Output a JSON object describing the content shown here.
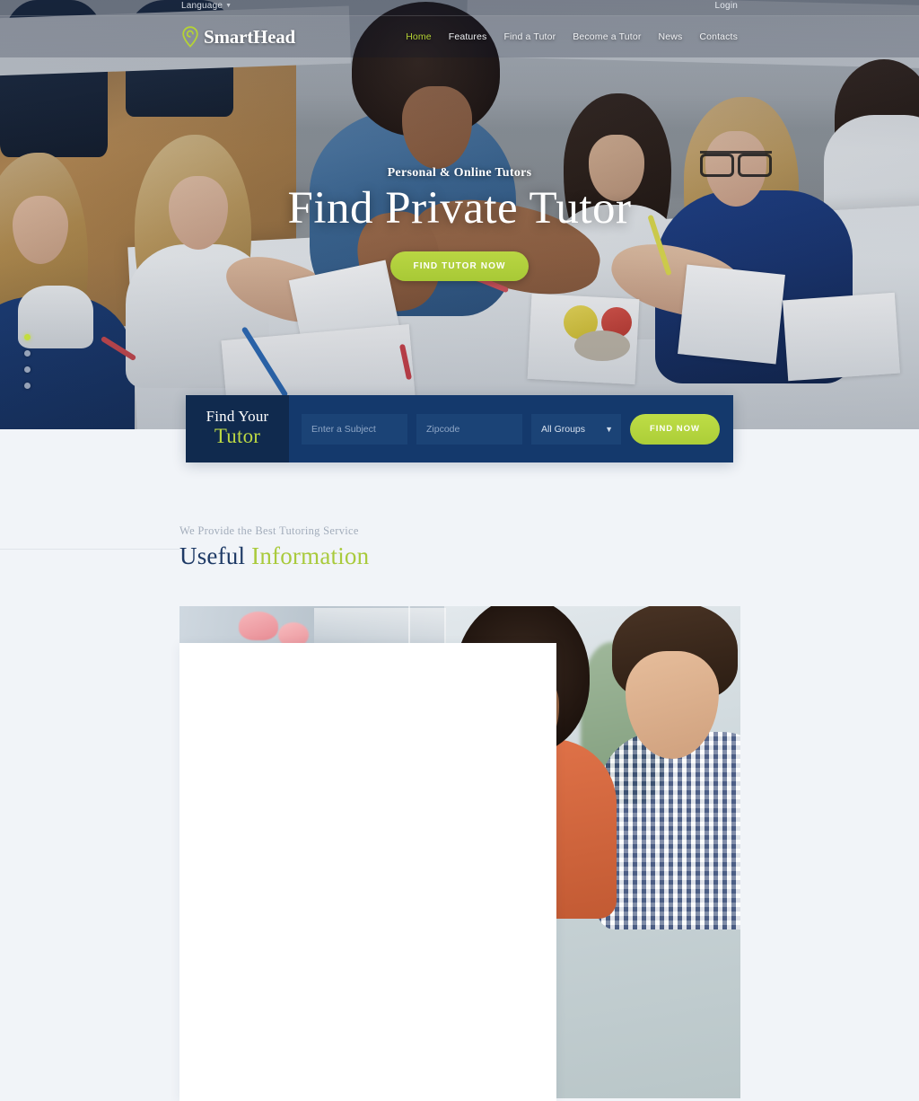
{
  "topbar": {
    "language_label": "Language",
    "language_chevron": "chevron-down-icon",
    "login_label": "Login"
  },
  "header": {
    "logo_text": "SmartHead",
    "logo_icon": "location-pin-icon",
    "nav": [
      {
        "label": "Home",
        "active": true
      },
      {
        "label": "Features",
        "active": false
      },
      {
        "label": "Find a Tutor",
        "active": false
      },
      {
        "label": "Become a Tutor",
        "active": false
      },
      {
        "label": "News",
        "active": false
      },
      {
        "label": "Contacts",
        "active": false
      }
    ]
  },
  "hero": {
    "subtitle": "Personal & Online Tutors",
    "title": "Find Private Tutor",
    "cta_label": "FIND TUTOR NOW",
    "slider_dots": 4,
    "active_dot": 1
  },
  "search_panel": {
    "label_line1": "Find Your",
    "label_line2": "Tutor",
    "subject_placeholder": "Enter a Subject",
    "subject_value": "",
    "zipcode_placeholder": "Zipcode",
    "zipcode_value": "",
    "group_selected": "All Groups",
    "group_options": [
      "All Groups"
    ],
    "group_chevron": "chevron-down-icon",
    "submit_label": "FIND NOW"
  },
  "section": {
    "eyebrow": "We Provide the Best Tutoring Service",
    "title_part1": "Useful",
    "title_part2": "Information"
  },
  "colors": {
    "green": "#b5d334",
    "navy": "#102a4e",
    "panel_blue": "#14396c",
    "field_blue": "#1b4376",
    "page_bg": "#f1f4f8",
    "heading_navy": "#1e3a66",
    "eyebrow_gray": "#a3adbb"
  }
}
